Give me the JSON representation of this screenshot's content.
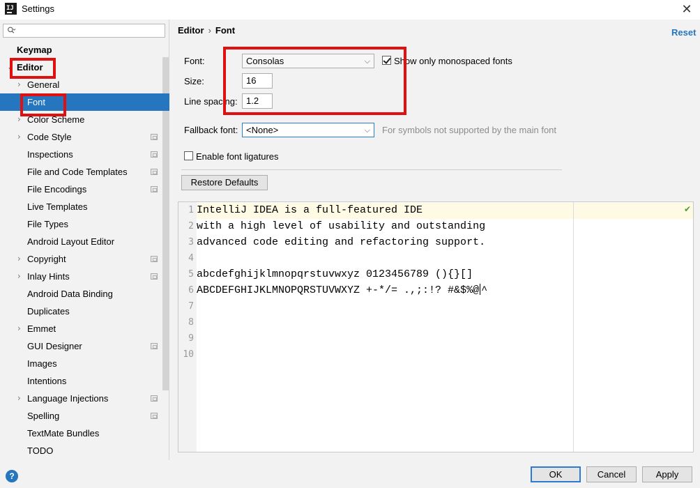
{
  "window": {
    "title": "Settings",
    "app_icon_text": "IJ",
    "close_glyph": "✕"
  },
  "sidebar": {
    "search_icon": "search-icon",
    "items": [
      {
        "label": "Keymap",
        "bold": true
      },
      {
        "label": "Editor",
        "bold": true,
        "expanded": true
      },
      {
        "label": "General",
        "chevron": true
      },
      {
        "label": "Font",
        "selected": true
      },
      {
        "label": "Color Scheme",
        "chevron": true
      },
      {
        "label": "Code Style",
        "chevron": true,
        "configurable": true
      },
      {
        "label": "Inspections",
        "configurable": true
      },
      {
        "label": "File and Code Templates",
        "configurable": true
      },
      {
        "label": "File Encodings",
        "configurable": true
      },
      {
        "label": "Live Templates"
      },
      {
        "label": "File Types"
      },
      {
        "label": "Android Layout Editor"
      },
      {
        "label": "Copyright",
        "chevron": true,
        "configurable": true
      },
      {
        "label": "Inlay Hints",
        "chevron": true,
        "configurable": true
      },
      {
        "label": "Android Data Binding"
      },
      {
        "label": "Duplicates"
      },
      {
        "label": "Emmet",
        "chevron": true
      },
      {
        "label": "GUI Designer",
        "configurable": true
      },
      {
        "label": "Images"
      },
      {
        "label": "Intentions"
      },
      {
        "label": "Language Injections",
        "chevron": true,
        "configurable": true
      },
      {
        "label": "Spelling",
        "configurable": true
      },
      {
        "label": "TextMate Bundles"
      },
      {
        "label": "TODO"
      }
    ]
  },
  "breadcrumb": {
    "parent": "Editor",
    "separator": "›",
    "current": "Font"
  },
  "reset_label": "Reset",
  "form": {
    "font_label": "Font:",
    "font_value": "Consolas",
    "monospaced_label": "Show only monospaced fonts",
    "monospaced_checked": true,
    "size_label": "Size:",
    "size_value": "16",
    "line_spacing_label": "Line spacing:",
    "line_spacing_value": "1.2",
    "fallback_label": "Fallback font:",
    "fallback_value": "<None>",
    "fallback_hint": "For symbols not supported by the main font",
    "ligatures_label": "Enable font ligatures",
    "ligatures_checked": false,
    "restore_label": "Restore Defaults",
    "dropdown_arrow": "⌵"
  },
  "preview": {
    "lines": [
      {
        "num": "1",
        "text": "IntelliJ IDEA is a full-featured IDE"
      },
      {
        "num": "2",
        "text": "with a high level of usability and outstanding"
      },
      {
        "num": "3",
        "text": "advanced code editing and refactoring support."
      },
      {
        "num": "4",
        "text": ""
      },
      {
        "num": "5",
        "text": "abcdefghijklmnopqrstuvwxyz 0123456789 (){}[]"
      },
      {
        "num": "6",
        "text_before_caret": "ABCDEFGHIJKLMNOPQRSTUVWXYZ +-*/= .,;:!? #&$%@",
        "text_after_caret": "^"
      },
      {
        "num": "7",
        "text": ""
      },
      {
        "num": "8",
        "text": ""
      },
      {
        "num": "9",
        "text": ""
      },
      {
        "num": "10",
        "text": ""
      }
    ],
    "inspection_glyph": "✔"
  },
  "buttons": {
    "ok": "OK",
    "cancel": "Cancel",
    "apply": "Apply",
    "help": "?"
  },
  "colors": {
    "selection": "#2675bf",
    "link": "#2675bf",
    "annotation": "#e01010",
    "caret_row": "#fffae3"
  }
}
